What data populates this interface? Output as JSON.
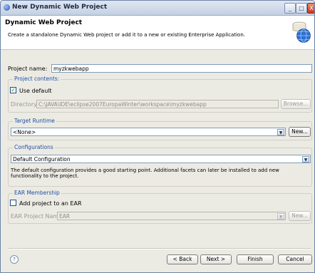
{
  "window": {
    "title": "New Dynamic Web Project",
    "controls": {
      "minimize": "_",
      "maximize": "□",
      "close": "X"
    }
  },
  "header": {
    "title": "Dynamic Web Project",
    "description": "Create a standalone Dynamic Web project or add it to a new or existing Enterprise Application."
  },
  "project_name": {
    "label": "Project name:",
    "value": "myzkwebapp"
  },
  "project_contents": {
    "legend": "Project contents:",
    "use_default_label": "Use default",
    "use_default_checked": true,
    "directory_label": "Directory:",
    "directory_value": "C:\\JAVA\\IDE\\eclipse2007EuropaWinter\\workspace\\myzkwebapp",
    "browse_label": "Browse..."
  },
  "target_runtime": {
    "legend": "Target Runtime",
    "value": "<None>",
    "new_label": "New..."
  },
  "configurations": {
    "legend": "Configurations",
    "value": "Default Configuration",
    "description": "The default configuration provides a good starting point. Additional facets can later be installed to add new functionality to the project."
  },
  "ear_membership": {
    "legend": "EAR Membership",
    "add_label": "Add project to an EAR",
    "add_checked": false,
    "ear_name_label": "EAR Project Name:",
    "ear_name_value": "EAR",
    "new_label": "New..."
  },
  "footer": {
    "help_glyph": "?",
    "back_label": "< Back",
    "next_label": "Next >",
    "finish_label": "Finish",
    "cancel_label": "Cancel"
  }
}
